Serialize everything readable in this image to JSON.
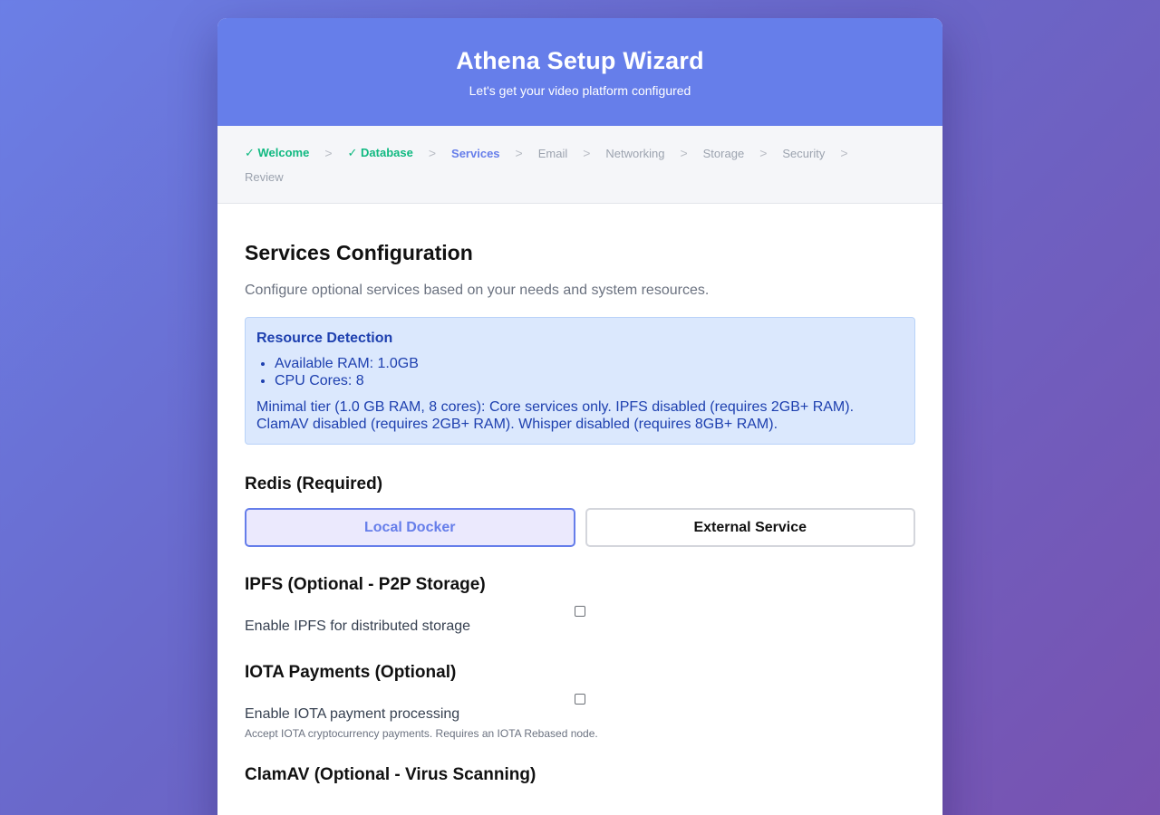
{
  "header": {
    "title": "Athena Setup Wizard",
    "subtitle": "Let's get your video platform configured"
  },
  "steps": {
    "separator": ">",
    "items": [
      {
        "label": "✓ Welcome",
        "state": "done"
      },
      {
        "label": "✓ Database",
        "state": "done"
      },
      {
        "label": "Services",
        "state": "active"
      },
      {
        "label": "Email",
        "state": "todo"
      },
      {
        "label": "Networking",
        "state": "todo"
      },
      {
        "label": "Storage",
        "state": "todo"
      },
      {
        "label": "Security",
        "state": "todo"
      },
      {
        "label": "Review",
        "state": "todo"
      }
    ]
  },
  "main": {
    "title": "Services Configuration",
    "intro": "Configure optional services based on your needs and system resources."
  },
  "resources": {
    "title": "Resource Detection",
    "items": [
      "Available RAM: 1.0GB",
      "CPU Cores: 8"
    ],
    "note": "Minimal tier (1.0 GB RAM, 8 cores): Core services only. IPFS disabled (requires 2GB+ RAM). ClamAV disabled (requires 2GB+ RAM). Whisper disabled (requires 8GB+ RAM)."
  },
  "redis": {
    "title": "Redis (Required)",
    "options": [
      "Local Docker",
      "External Service"
    ],
    "selected": "Local Docker"
  },
  "ipfs": {
    "title": "IPFS (Optional - P2P Storage)",
    "checkbox_label": "Enable IPFS for distributed storage",
    "checked": false
  },
  "iota": {
    "title": "IOTA Payments (Optional)",
    "checkbox_label": "Enable IOTA payment processing",
    "checked": false,
    "hint": "Accept IOTA cryptocurrency payments. Requires an IOTA Rebased node."
  },
  "clamav": {
    "title": "ClamAV (Optional - Virus Scanning)"
  },
  "colors": {
    "accent": "#667eea",
    "done": "#10b981",
    "info_bg": "#dbe8fd",
    "info_text": "#1e40af"
  }
}
